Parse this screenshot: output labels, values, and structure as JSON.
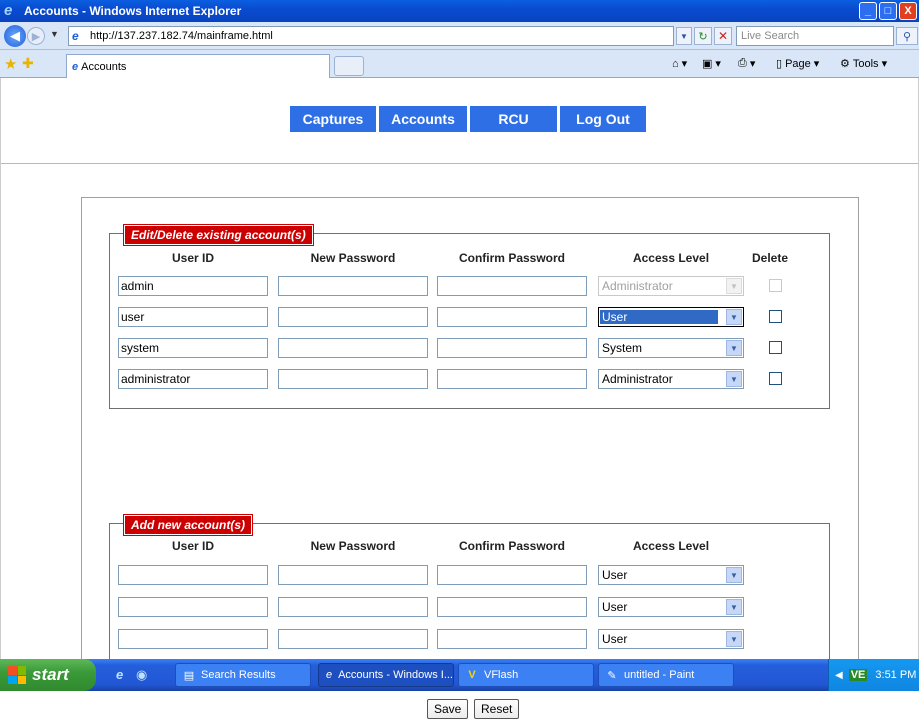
{
  "window": {
    "title": "Accounts - Windows Internet Explorer",
    "minimize": "_",
    "maximize": "□",
    "close": "X"
  },
  "addressbar": {
    "url": "http://137.237.182.74/mainframe.html",
    "search_placeholder": "Live Search"
  },
  "tabbar": {
    "tab_title": "Accounts",
    "page_menu": "Page",
    "tools_menu": "Tools"
  },
  "nav": {
    "items": [
      {
        "label": "Captures"
      },
      {
        "label": "Accounts"
      },
      {
        "label": "RCU"
      },
      {
        "label": "Log Out"
      }
    ],
    "color": "#2f6fe6"
  },
  "edit_section": {
    "legend": "Edit/Delete existing account(s)",
    "headers": {
      "user_id": "User ID",
      "new_password": "New Password",
      "confirm_password": "Confirm Password",
      "access_level": "Access Level",
      "delete": "Delete"
    },
    "rows": [
      {
        "user_id": "admin",
        "new_password": "",
        "confirm_password": "",
        "access_level": "Administrator",
        "access_disabled": true,
        "delete_checked": false,
        "delete_disabled": true
      },
      {
        "user_id": "user",
        "new_password": "",
        "confirm_password": "",
        "access_level": "User",
        "access_disabled": false,
        "delete_checked": false,
        "delete_disabled": false
      },
      {
        "user_id": "system",
        "new_password": "",
        "confirm_password": "",
        "access_level": "System",
        "access_disabled": false,
        "delete_checked": false,
        "delete_disabled": false
      },
      {
        "user_id": "administrator",
        "new_password": "",
        "confirm_password": "",
        "access_level": "Administrator",
        "access_disabled": false,
        "delete_checked": false,
        "delete_disabled": false
      }
    ]
  },
  "add_section": {
    "legend": "Add new account(s)",
    "headers": {
      "user_id": "User ID",
      "new_password": "New Password",
      "confirm_password": "Confirm Password",
      "access_level": "Access Level"
    },
    "rows": [
      {
        "user_id": "",
        "new_password": "",
        "confirm_password": "",
        "access_level": "User"
      },
      {
        "user_id": "",
        "new_password": "",
        "confirm_password": "",
        "access_level": "User"
      },
      {
        "user_id": "",
        "new_password": "",
        "confirm_password": "",
        "access_level": "User"
      }
    ]
  },
  "actions": {
    "save": "Save",
    "reset": "Reset"
  },
  "taskbar": {
    "start": "start",
    "items": [
      {
        "label": "Search Results",
        "icon": "search-results-icon"
      },
      {
        "label": "Accounts - Windows I...",
        "icon": "ie-icon",
        "active": true
      },
      {
        "label": "VFlash",
        "icon": "vflash-icon"
      },
      {
        "label": "untitled - Paint",
        "icon": "paint-icon"
      }
    ],
    "tray_badge": "VE",
    "clock": "3:51 PM"
  },
  "colors": {
    "legend_red": "#cc0000",
    "selection_blue": "#316ac5",
    "xp_blue": "#245edb"
  }
}
